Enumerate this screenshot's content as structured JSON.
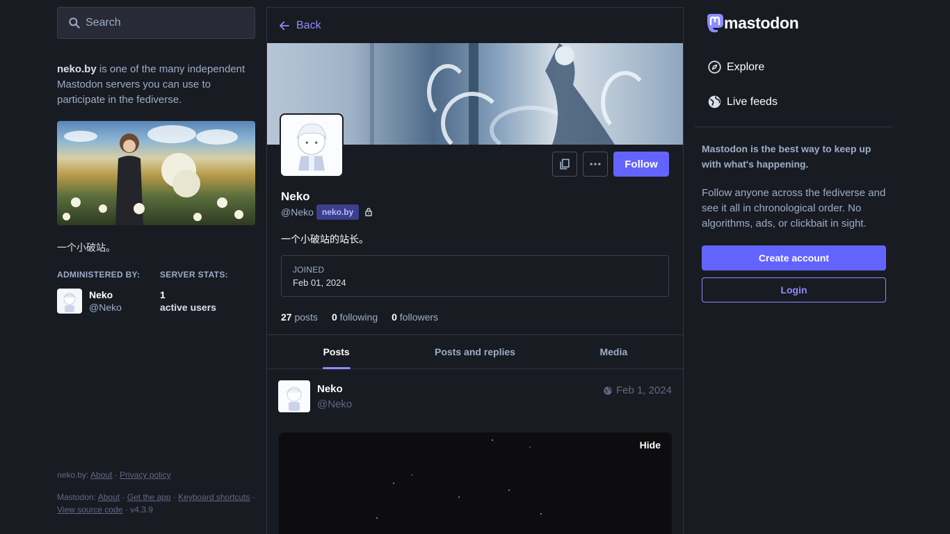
{
  "search": {
    "placeholder": "Search"
  },
  "server": {
    "domain": "neko.by",
    "description_tail": " is one of the many independent Mastodon servers you can use to participate in the fediverse.",
    "short_description": "一个小破站。",
    "admin_title": "ADMINISTERED BY:",
    "admin_name": "Neko",
    "admin_acct": "@Neko",
    "stats_title": "SERVER STATS:",
    "active_users_count": "1",
    "active_users_label": "active users"
  },
  "footer": {
    "server_prefix": "neko.by:",
    "server_about": "About",
    "privacy": "Privacy policy",
    "mastodon_prefix": "Mastodon:",
    "mastodon_about": "About",
    "get_app": "Get the app",
    "keyboard": "Keyboard shortcuts",
    "source": "View source code",
    "version": "v4.3.9",
    "sep": "·"
  },
  "profile": {
    "back_label": "Back",
    "follow_label": "Follow",
    "name": "Neko",
    "acct": "@Neko",
    "domain_badge": "neko.by",
    "bio": "一个小破站的站长。",
    "joined_label": "JOINED",
    "joined_date": "Feb 01, 2024",
    "posts_count": "27",
    "posts_label": "posts",
    "following_count": "0",
    "following_label": "following",
    "followers_count": "0",
    "followers_label": "followers",
    "tabs": [
      "Posts",
      "Posts and replies",
      "Media"
    ]
  },
  "post": {
    "name": "Neko",
    "acct": "@Neko",
    "date": "Feb 1, 2024",
    "hide_label": "Hide"
  },
  "sidebar": {
    "logo_text": "mastodon",
    "explore": "Explore",
    "live_feeds": "Live feeds",
    "pitch_headline": "Mastodon is the best way to keep up with what's happening.",
    "pitch_body": "Follow anyone across the fediverse and see it all in chronological order. No algorithms, ads, or clickbait in sight.",
    "create_account": "Create account",
    "login": "Login"
  },
  "colors": {
    "background": "#191b22",
    "accent": "#6364ff",
    "link": "#8c8dff",
    "muted": "#9baec8"
  }
}
